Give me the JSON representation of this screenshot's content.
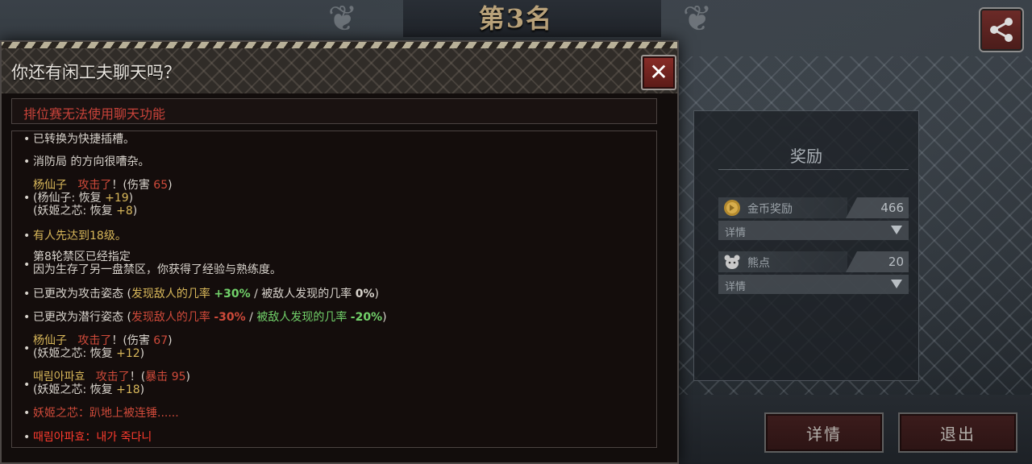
{
  "background": {
    "rank_title": "第3名"
  },
  "share": {
    "icon": "share-icon"
  },
  "reward_panel": {
    "title": "奖励",
    "rows": [
      {
        "icon": "gold-coin-icon",
        "label": "金币奖励",
        "value": "466",
        "detail": "详情"
      },
      {
        "icon": "bear-point-icon",
        "label": "熊点",
        "value": "20",
        "detail": "详情"
      }
    ]
  },
  "buttons": {
    "detail": "详情",
    "exit": "退出"
  },
  "chat_modal": {
    "title": "你还有闲工夫聊天吗？",
    "close_icon": "close-icon",
    "notice": "排位赛无法使用聊天功能",
    "messages": {
      "m0": "已转换为快捷插槽。",
      "m1": "消防局 的方向很嘈杂。",
      "m2": {
        "name": "杨仙子",
        "attack": "攻击了",
        "mid": "！(伤害",
        "num": "65",
        "end": ")",
        "l2a": "(杨仙子: 恢复",
        "l2b": "+19",
        "l2c": ")",
        "l3a": "(妖姬之芯: 恢复",
        "l3b": "+8",
        "l3c": ")"
      },
      "m3": "有人先达到18级。",
      "m4": {
        "l1": "第8轮禁区已经指定",
        "l2": "因为生存了另一盘禁区，你获得了经验与熟练度。"
      },
      "m5": {
        "a": "已更改为攻击姿态 (",
        "b": "发现敌人的几率",
        "c": "+30%",
        "d": "/",
        "e": "被敌人发现的几率",
        "f": "0%",
        "g": ")"
      },
      "m6": {
        "a": "已更改为潜行姿态 (",
        "b": "发现敌人的几率",
        "c": "-30%",
        "d": "/",
        "e": "被敌人发现的几率",
        "f": "-20%",
        "g": ")"
      },
      "m7": {
        "name": "杨仙子",
        "attack": "攻击了",
        "mid": "！(伤害",
        "num": "67",
        "end": ")",
        "l2a": "(妖姬之芯: 恢复",
        "l2b": "+12",
        "l2c": ")"
      },
      "m8": {
        "name": "때림아파효",
        "attack": "攻击了",
        "mid": "！(",
        "crit": "暴击",
        "num": "95",
        "end": ")",
        "l2a": "(妖姬之芯: 恢复",
        "l2b": "+18",
        "l2c": ")"
      },
      "m9": "妖姬之芯：趴地上被连锤......",
      "m10": "때림아파효：내가 죽다니"
    }
  },
  "colors": {
    "accent_red": "#cf4a3a",
    "gold": "#d8b75a",
    "green": "#72d26a",
    "bright_red": "#ff3b2e"
  }
}
